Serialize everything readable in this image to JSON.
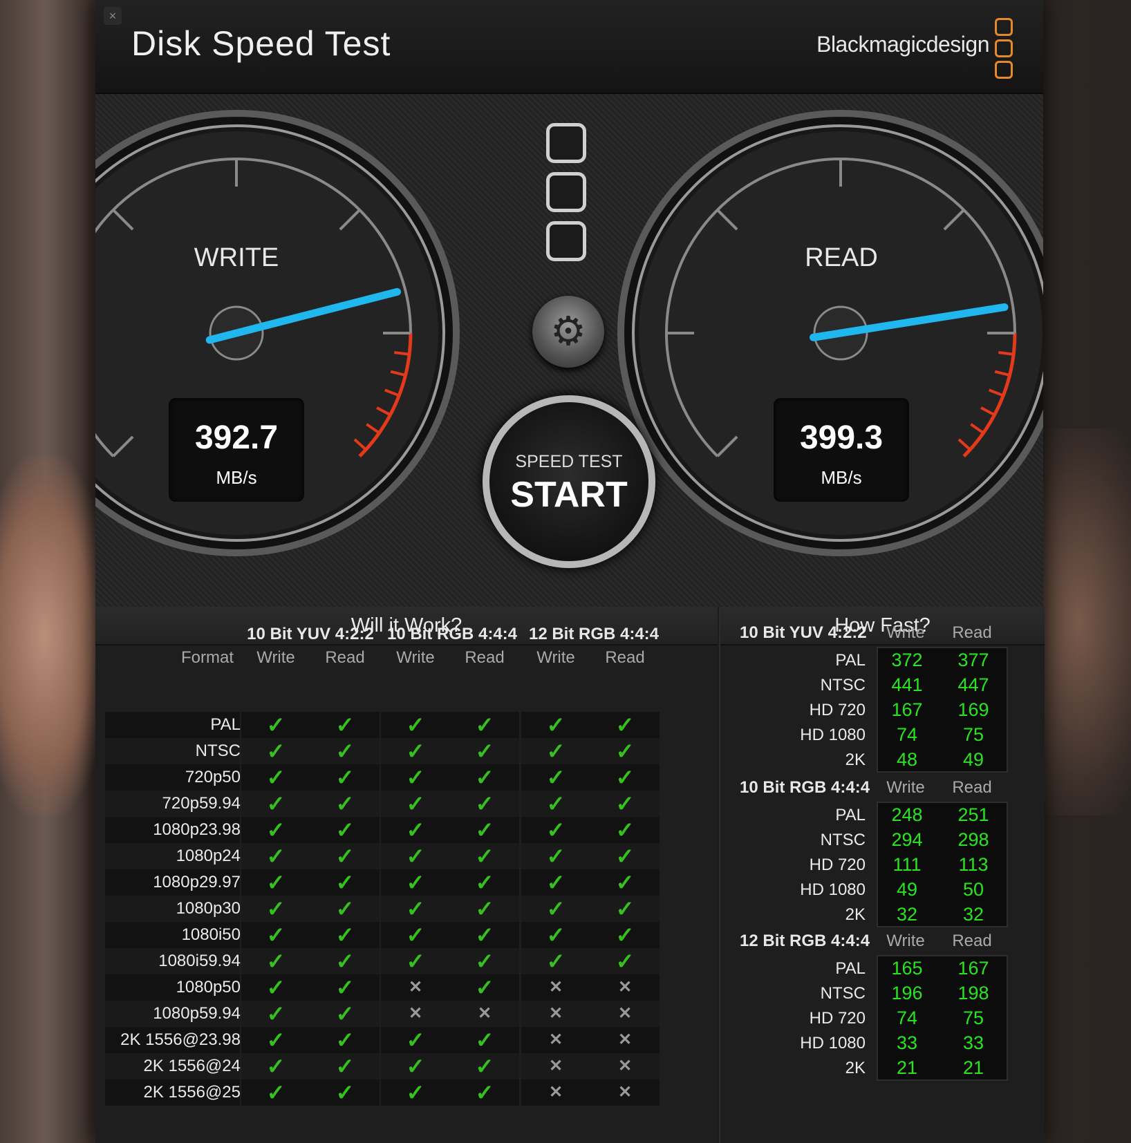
{
  "window": {
    "close_symbol": "×",
    "title": "Disk Speed Test",
    "brand": "Blackmagicdesign"
  },
  "gauges": {
    "write": {
      "label": "WRITE",
      "value": "392.7",
      "unit": "MB/s",
      "needle_fraction": 0.78
    },
    "read": {
      "label": "READ",
      "value": "399.3",
      "unit": "MB/s",
      "needle_fraction": 0.8
    }
  },
  "controls": {
    "settings_icon": "gear-icon",
    "start_sub": "SPEED TEST",
    "start_main": "START"
  },
  "will_it_work": {
    "header": "Will it Work?",
    "format_label": "Format",
    "groups": [
      "10 Bit YUV 4:2:2",
      "10 Bit RGB 4:4:4",
      "12 Bit RGB 4:4:4"
    ],
    "write_label": "Write",
    "read_label": "Read",
    "rows": [
      {
        "format": "PAL",
        "marks": [
          1,
          1,
          1,
          1,
          1,
          1
        ]
      },
      {
        "format": "NTSC",
        "marks": [
          1,
          1,
          1,
          1,
          1,
          1
        ]
      },
      {
        "format": "720p50",
        "marks": [
          1,
          1,
          1,
          1,
          1,
          1
        ]
      },
      {
        "format": "720p59.94",
        "marks": [
          1,
          1,
          1,
          1,
          1,
          1
        ]
      },
      {
        "format": "1080p23.98",
        "marks": [
          1,
          1,
          1,
          1,
          1,
          1
        ]
      },
      {
        "format": "1080p24",
        "marks": [
          1,
          1,
          1,
          1,
          1,
          1
        ]
      },
      {
        "format": "1080p29.97",
        "marks": [
          1,
          1,
          1,
          1,
          1,
          1
        ]
      },
      {
        "format": "1080p30",
        "marks": [
          1,
          1,
          1,
          1,
          1,
          1
        ]
      },
      {
        "format": "1080i50",
        "marks": [
          1,
          1,
          1,
          1,
          1,
          1
        ]
      },
      {
        "format": "1080i59.94",
        "marks": [
          1,
          1,
          1,
          1,
          1,
          1
        ]
      },
      {
        "format": "1080p50",
        "marks": [
          1,
          1,
          0,
          1,
          0,
          0
        ]
      },
      {
        "format": "1080p59.94",
        "marks": [
          1,
          1,
          0,
          0,
          0,
          0
        ]
      },
      {
        "format": "2K 1556@23.98",
        "marks": [
          1,
          1,
          1,
          1,
          0,
          0
        ]
      },
      {
        "format": "2K 1556@24",
        "marks": [
          1,
          1,
          1,
          1,
          0,
          0
        ]
      },
      {
        "format": "2K 1556@25",
        "marks": [
          1,
          1,
          1,
          1,
          0,
          0
        ]
      }
    ],
    "ok_symbol": "✓",
    "no_symbol": "✕"
  },
  "how_fast": {
    "header": "How Fast?",
    "write_label": "Write",
    "read_label": "Read",
    "groups": [
      {
        "title": "10 Bit YUV 4:2:2",
        "rows": [
          {
            "label": "PAL",
            "write": "372",
            "read": "377"
          },
          {
            "label": "NTSC",
            "write": "441",
            "read": "447"
          },
          {
            "label": "HD 720",
            "write": "167",
            "read": "169"
          },
          {
            "label": "HD 1080",
            "write": "74",
            "read": "75"
          },
          {
            "label": "2K",
            "write": "48",
            "read": "49"
          }
        ]
      },
      {
        "title": "10 Bit RGB 4:4:4",
        "rows": [
          {
            "label": "PAL",
            "write": "248",
            "read": "251"
          },
          {
            "label": "NTSC",
            "write": "294",
            "read": "298"
          },
          {
            "label": "HD 720",
            "write": "111",
            "read": "113"
          },
          {
            "label": "HD 1080",
            "write": "49",
            "read": "50"
          },
          {
            "label": "2K",
            "write": "32",
            "read": "32"
          }
        ]
      },
      {
        "title": "12 Bit RGB 4:4:4",
        "rows": [
          {
            "label": "PAL",
            "write": "165",
            "read": "167"
          },
          {
            "label": "NTSC",
            "write": "196",
            "read": "198"
          },
          {
            "label": "HD 720",
            "write": "74",
            "read": "75"
          },
          {
            "label": "HD 1080",
            "write": "33",
            "read": "33"
          },
          {
            "label": "2K",
            "write": "21",
            "read": "21"
          }
        ]
      }
    ]
  },
  "colors": {
    "needle": "#1fb7ee",
    "ok": "#36c21e",
    "value_green": "#28e61e",
    "brand_orange": "#e58a2b",
    "redline": "#e5391b"
  }
}
